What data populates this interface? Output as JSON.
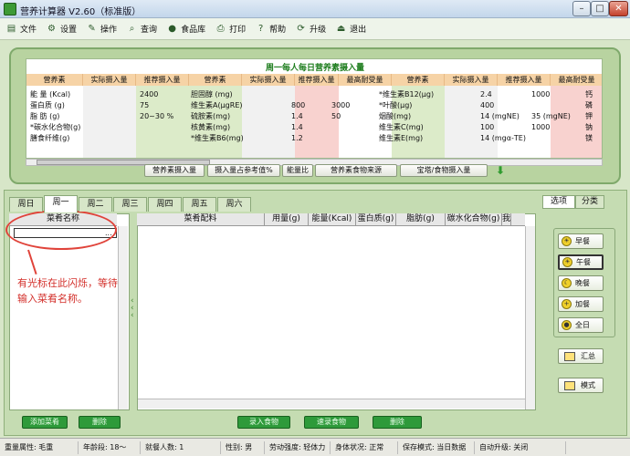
{
  "window": {
    "title": "营养计算器 V2.60（标准版）",
    "minimize": "–",
    "maximize": "□",
    "close": "✕"
  },
  "toolbar": [
    {
      "label": "文件",
      "icon": "document-icon"
    },
    {
      "label": "设置",
      "icon": "settings-icon"
    },
    {
      "label": "操作",
      "icon": "operate-icon"
    },
    {
      "label": "查询",
      "icon": "query-icon"
    },
    {
      "label": "食品库",
      "icon": "food-library-icon"
    },
    {
      "label": "打印",
      "icon": "print-icon"
    },
    {
      "label": "帮助",
      "icon": "help-icon"
    },
    {
      "label": "升级",
      "icon": "upgrade-icon"
    },
    {
      "label": "退出",
      "icon": "exit-icon"
    }
  ],
  "nutrients": {
    "title": "周一每人每日营养素摄入量",
    "headers": [
      "营养素",
      "实际摄入量",
      "推荐摄入量",
      "营养素",
      "实际摄入量",
      "推荐摄入量",
      "最高耐受量",
      "营养素",
      "实际摄入量",
      "推荐摄入量",
      "最高耐受量"
    ],
    "col1_names": [
      "能 量 (Kcal)",
      "蛋白质 (g)",
      "脂 肪 (g)",
      "*碳水化合物(g)",
      "膳食纤维(g)"
    ],
    "col1_recommended": [
      "2400",
      "75",
      "20~30 %",
      "",
      ""
    ],
    "col2_names": [
      "胆固醇 (mg)",
      "维生素A(μgRE)",
      "硫胺素(mg)",
      "核黄素(mg)",
      "*维生素B6(mg)"
    ],
    "col2_recommended": [
      "",
      "800",
      "1.4",
      "1.4",
      "1.2"
    ],
    "col2_max": [
      "",
      "3000",
      "50",
      "",
      ""
    ],
    "col3_names": [
      "*维生素B12(μg)",
      "*叶酸(μg)",
      "烟酸(mg)",
      "维生素C(mg)",
      "维生素E(mg)"
    ],
    "col3_recommended": [
      "2.4",
      "400",
      "14 (mgNE)",
      "100",
      "14 (mgα-TE)"
    ],
    "col3_max": [
      "1000",
      "",
      "35 (mgNE)",
      "1000",
      ""
    ],
    "col4_names": [
      "钙",
      "磷",
      "钾",
      "钠",
      "镁"
    ]
  },
  "top_buttons": [
    "营养素摄入量",
    "摄入量占参考值%",
    "能量比",
    "营养素食物来源",
    "宝塔/食物摄入量"
  ],
  "day_tabs": [
    "周日",
    "周一",
    "周二",
    "周三",
    "周四",
    "周五",
    "周六"
  ],
  "active_day": "周一",
  "dish_header": "菜肴名称",
  "dish_input_dots": "...",
  "annotation": "有光标在此闪烁，等待输入菜肴名称。",
  "ingredient_headers": [
    "菜肴配料",
    "用量(g)",
    "能量(Kcal)",
    "蛋白质(g)",
    "脂肪(g)",
    "碳水化合物(g)",
    "我"
  ],
  "bottom_buttons": {
    "add_dish": "添加菜肴",
    "delete_dish": "删除",
    "record_food": "录入食物",
    "select_food": "速录食物",
    "delete_food": "删除"
  },
  "right_tabs": [
    "选项",
    "分类"
  ],
  "meals": [
    {
      "label": "早餐",
      "icon": "sun-icon",
      "symbol": "☀",
      "selected": false
    },
    {
      "label": "午餐",
      "icon": "sun-icon",
      "symbol": "☀",
      "selected": true
    },
    {
      "label": "晚餐",
      "icon": "moon-icon",
      "symbol": "☾",
      "selected": false
    },
    {
      "label": "加餐",
      "icon": "plus-icon",
      "symbol": "+",
      "selected": false
    },
    {
      "label": "全日",
      "icon": "circle-icon",
      "symbol": "●",
      "selected": false
    }
  ],
  "summary_button": "汇总",
  "mode_button": "模式",
  "status": [
    "重量属性: 毛重",
    "年龄段: 18～",
    "就餐人数: 1",
    "性别: 男",
    "劳动强度: 轻体力",
    "身体状况: 正常",
    "保存模式: 当日数据",
    "自动升级: 关闭"
  ],
  "colors": {
    "accent_green": "#2e9a3a",
    "panel_green": "#b8d3a0",
    "annotation_red": "#e0433a"
  }
}
